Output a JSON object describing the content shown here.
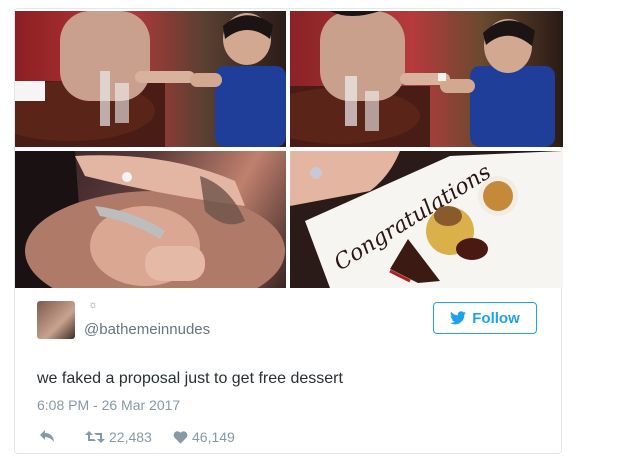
{
  "tweet": {
    "handle": "@bathemeinnudes",
    "text": "we faked a proposal just to get free dessert",
    "timestamp": "6:08 PM - 26 Mar 2017",
    "follow_label": "Follow",
    "retweets": "22,483",
    "likes": "46,149",
    "plate_text": "Congratulations"
  },
  "colors": {
    "accent": "#1da1f2",
    "muted": "#8899a6",
    "text": "#292f33",
    "border": "#e1e8ed"
  },
  "icons": {
    "follow": "twitter-bird-icon",
    "reply": "reply-icon",
    "retweet": "retweet-icon",
    "like": "heart-icon"
  }
}
